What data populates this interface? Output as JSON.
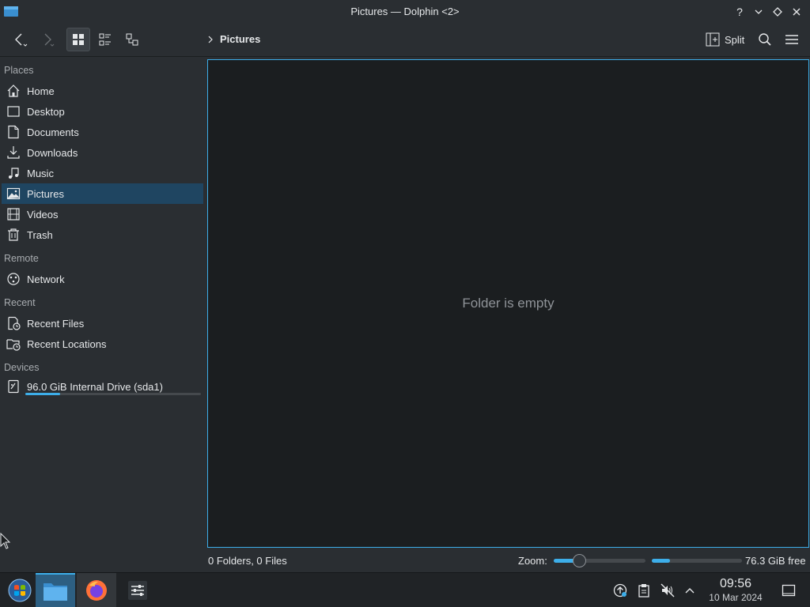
{
  "window": {
    "title": "Pictures — Dolphin <2>",
    "controls": [
      "?",
      "minimize",
      "maximize",
      "close"
    ]
  },
  "toolbar": {
    "view_modes": [
      "icons-view",
      "compact-view",
      "details-view"
    ],
    "active_view": "icons-view",
    "breadcrumb": "Pictures",
    "split_label": "Split"
  },
  "sidebar": {
    "sections": {
      "places": "Places",
      "remote": "Remote",
      "recent": "Recent",
      "devices": "Devices"
    },
    "places": [
      {
        "label": "Home",
        "icon": "home-icon"
      },
      {
        "label": "Desktop",
        "icon": "desktop-icon"
      },
      {
        "label": "Documents",
        "icon": "documents-icon"
      },
      {
        "label": "Downloads",
        "icon": "downloads-icon"
      },
      {
        "label": "Music",
        "icon": "music-icon"
      },
      {
        "label": "Pictures",
        "icon": "pictures-icon",
        "selected": true
      },
      {
        "label": "Videos",
        "icon": "videos-icon"
      },
      {
        "label": "Trash",
        "icon": "trash-icon"
      }
    ],
    "remote": [
      {
        "label": "Network",
        "icon": "network-icon"
      }
    ],
    "recent": [
      {
        "label": "Recent Files",
        "icon": "recent-files-icon"
      },
      {
        "label": "Recent Locations",
        "icon": "recent-locations-icon"
      }
    ],
    "devices": [
      {
        "label": "96.0 GiB Internal Drive (sda1)",
        "icon": "drive-icon",
        "usage_fraction": 0.2
      }
    ]
  },
  "main": {
    "empty_message": "Folder is empty"
  },
  "statusbar": {
    "summary": "0 Folders, 0 Files",
    "zoom_label": "Zoom:",
    "zoom_fraction": 0.28,
    "free_space": "76.3 GiB free",
    "free_space_used_fraction": 0.2
  },
  "taskbar": {
    "apps": [
      "start-menu",
      "dolphin",
      "firefox",
      "system-settings"
    ],
    "clock_time": "09:56",
    "clock_date": "10 Mar 2024"
  },
  "colors": {
    "accent": "#3daee9",
    "selection": "#1f4561",
    "window_bg": "#2a2e32",
    "view_bg": "#1b1e20"
  }
}
